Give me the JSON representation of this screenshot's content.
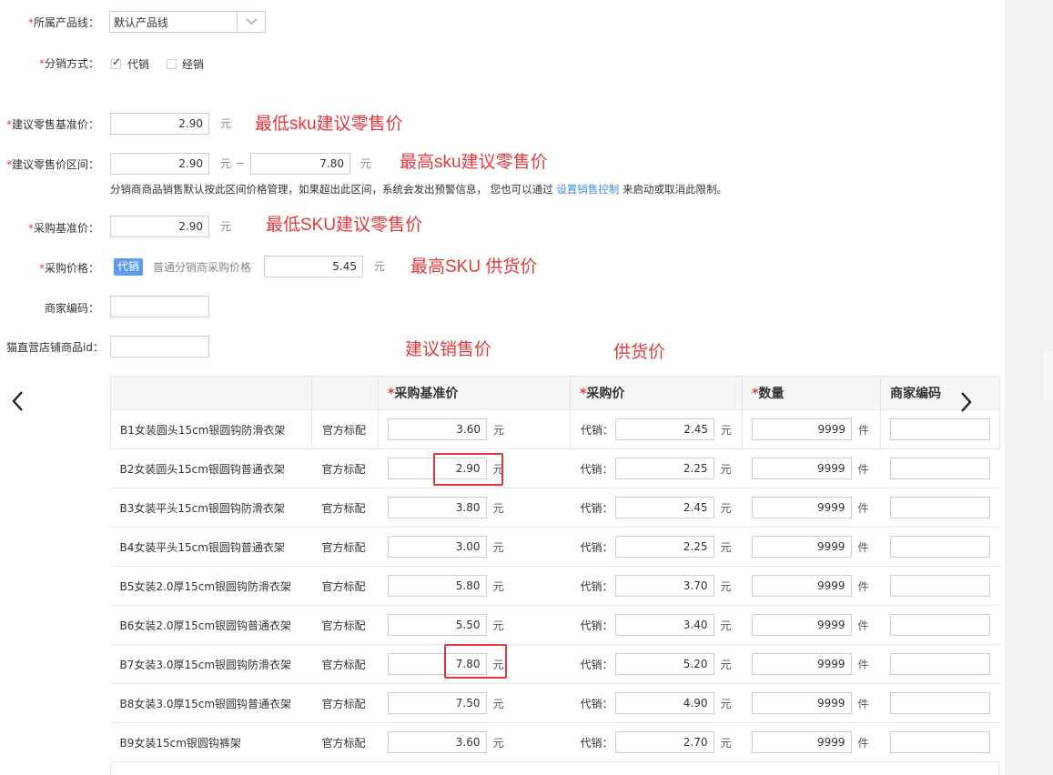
{
  "form": {
    "product_line": {
      "label": "所属产品线：",
      "value": "默认产品线"
    },
    "dist_mode": {
      "label": "分销方式：",
      "options": [
        {
          "label": "代销",
          "checked": true
        },
        {
          "label": "经销",
          "checked": false
        }
      ]
    },
    "retail_base": {
      "label": "建议零售基准价：",
      "value": "2.90",
      "unit": "元"
    },
    "retail_range": {
      "label": "建议零售价区间：",
      "min": "2.90",
      "max": "7.80",
      "unit_min": "元",
      "dash": "－",
      "unit_max": "元"
    },
    "range_note": {
      "before": "分销商商品销售默认按此区间价格管理，如果超出此区间，系统会发出预警信息，  您也可以通过",
      "link": "设置销售控制",
      "after": "来启动或取消此限制。"
    },
    "purchase_base": {
      "label": "采购基准价：",
      "value": "2.90",
      "unit": "元"
    },
    "purchase_price": {
      "label": "采购价格：",
      "badge": "代销",
      "sub_label": "普通分销商采购价格",
      "value": "5.45",
      "unit": "元"
    },
    "merchant_code": {
      "label": "商家编码：",
      "value": ""
    },
    "tmall_id": {
      "label": "猫直营店铺商品id：",
      "value": ""
    }
  },
  "annotations": {
    "a1": "最低sku建议零售价",
    "a2": "最高sku建议零售价",
    "a3": "最低SKU建议零售价",
    "a4": "最高SKU 供货价",
    "a5": "建议销售价",
    "a6": "供货价"
  },
  "table": {
    "headers": {
      "base": "采购基准价",
      "purchase": "采购价",
      "qty": "数量",
      "code": "商家编码"
    },
    "star": "*",
    "rows": [
      {
        "name": "B1女装圆头15cm银圆钩防滑衣架",
        "std": "官方标配",
        "base": "3.60",
        "base_unit": "元",
        "agent_label": "代销：",
        "purchase": "2.45",
        "purchase_unit": "元",
        "qty": "9999",
        "qty_unit": "件"
      },
      {
        "name": "B2女装圆头15cm银圆钩普通衣架",
        "std": "官方标配",
        "base": "2.90",
        "base_unit": "元",
        "agent_label": "代销：",
        "purchase": "2.25",
        "purchase_unit": "元",
        "qty": "9999",
        "qty_unit": "件"
      },
      {
        "name": "B3女装平头15cm银圆钩防滑衣架",
        "std": "官方标配",
        "base": "3.80",
        "base_unit": "元",
        "agent_label": "代销：",
        "purchase": "2.45",
        "purchase_unit": "元",
        "qty": "9999",
        "qty_unit": "件"
      },
      {
        "name": "B4女装平头15cm银圆钩普通衣架",
        "std": "官方标配",
        "base": "3.00",
        "base_unit": "元",
        "agent_label": "代销：",
        "purchase": "2.25",
        "purchase_unit": "元",
        "qty": "9999",
        "qty_unit": "件"
      },
      {
        "name": "B5女装2.0厚15cm银圆钩防滑衣架",
        "std": "官方标配",
        "base": "5.80",
        "base_unit": "元",
        "agent_label": "代销：",
        "purchase": "3.70",
        "purchase_unit": "元",
        "qty": "9999",
        "qty_unit": "件"
      },
      {
        "name": "B6女装2.0厚15cm银圆钩普通衣架",
        "std": "官方标配",
        "base": "5.50",
        "base_unit": "元",
        "agent_label": "代销：",
        "purchase": "3.40",
        "purchase_unit": "元",
        "qty": "9999",
        "qty_unit": "件"
      },
      {
        "name": "B7女装3.0厚15cm银圆钩防滑衣架",
        "std": "官方标配",
        "base": "7.80",
        "base_unit": "元",
        "agent_label": "代销：",
        "purchase": "5.20",
        "purchase_unit": "元",
        "qty": "9999",
        "qty_unit": "件"
      },
      {
        "name": "B8女装3.0厚15cm银圆钩普通衣架",
        "std": "官方标配",
        "base": "7.50",
        "base_unit": "元",
        "agent_label": "代销：",
        "purchase": "4.90",
        "purchase_unit": "元",
        "qty": "9999",
        "qty_unit": "件"
      },
      {
        "name": "B9女装15cm银圆钩裤架",
        "std": "官方标配",
        "base": "3.60",
        "base_unit": "元",
        "agent_label": "代销：",
        "purchase": "2.70",
        "purchase_unit": "元",
        "qty": "9999",
        "qty_unit": "件"
      }
    ]
  },
  "nav": {
    "prev": "‹",
    "next": "›"
  },
  "colors": {
    "required": "#e4393c",
    "link": "#3c8dde",
    "badge": "#5b9bf0"
  }
}
